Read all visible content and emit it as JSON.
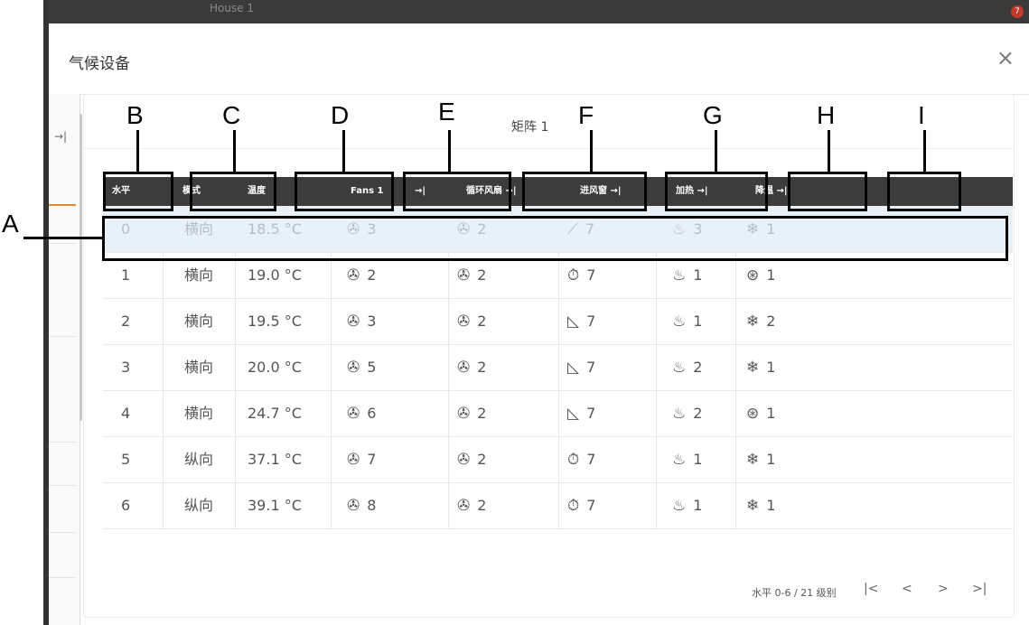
{
  "background": {
    "window_title": "House 1",
    "badge": "7"
  },
  "dialog": {
    "title": "气候设备",
    "close": "×",
    "side_arrow": "→|"
  },
  "matrix": {
    "title": "矩阵 1"
  },
  "table": {
    "headers": [
      {
        "id": "level",
        "label": "水平"
      },
      {
        "id": "mode",
        "label": "模式"
      },
      {
        "id": "temp",
        "label": "温度"
      },
      {
        "id": "fans",
        "label": "Fans 1"
      },
      {
        "id": "fans_arrow",
        "label": "→|"
      },
      {
        "id": "circ",
        "label": "循环风扇 →|"
      },
      {
        "id": "inlet",
        "label": "进风窗 →|"
      },
      {
        "id": "heat",
        "label": "加热 →|"
      },
      {
        "id": "cool",
        "label": "降温 →|"
      }
    ],
    "rows": [
      {
        "level": "0",
        "mode": "横向",
        "temp": "18.5 °C",
        "fans": "3",
        "circ": "2",
        "inlet": "7",
        "inlet_icon": "⟋",
        "heat": "3",
        "cool": "1",
        "cool_icon": "❄"
      },
      {
        "level": "1",
        "mode": "横向",
        "temp": "19.0 °C",
        "fans": "2",
        "circ": "2",
        "inlet": "7",
        "inlet_icon": "⏱",
        "heat": "1",
        "cool": "1",
        "cool_icon": "⊛"
      },
      {
        "level": "2",
        "mode": "横向",
        "temp": "19.5 °C",
        "fans": "3",
        "circ": "2",
        "inlet": "7",
        "inlet_icon": "◺",
        "heat": "1",
        "cool": "2",
        "cool_icon": "❄"
      },
      {
        "level": "3",
        "mode": "横向",
        "temp": "20.0 °C",
        "fans": "5",
        "circ": "2",
        "inlet": "7",
        "inlet_icon": "◺",
        "heat": "2",
        "cool": "1",
        "cool_icon": "❄"
      },
      {
        "level": "4",
        "mode": "横向",
        "temp": "24.7 °C",
        "fans": "6",
        "circ": "2",
        "inlet": "7",
        "inlet_icon": "◺",
        "heat": "2",
        "cool": "1",
        "cool_icon": "⊛"
      },
      {
        "level": "5",
        "mode": "纵向",
        "temp": "37.1 °C",
        "fans": "7",
        "circ": "2",
        "inlet": "7",
        "inlet_icon": "⏱",
        "heat": "1",
        "cool": "1",
        "cool_icon": "❄"
      },
      {
        "level": "6",
        "mode": "纵向",
        "temp": "39.1 °C",
        "fans": "8",
        "circ": "2",
        "inlet": "7",
        "inlet_icon": "⏱",
        "heat": "1",
        "cool": "1",
        "cool_icon": "❄"
      }
    ],
    "icons": {
      "fan": "fan-icon",
      "heat": "flame-icon"
    }
  },
  "pager": {
    "info": "水平 0-6 / 21 级别",
    "first": "|<",
    "prev": "<",
    "next": ">",
    "last": ">|"
  },
  "annotations": [
    "A",
    "B",
    "C",
    "D",
    "E",
    "F",
    "G",
    "H",
    "I"
  ]
}
